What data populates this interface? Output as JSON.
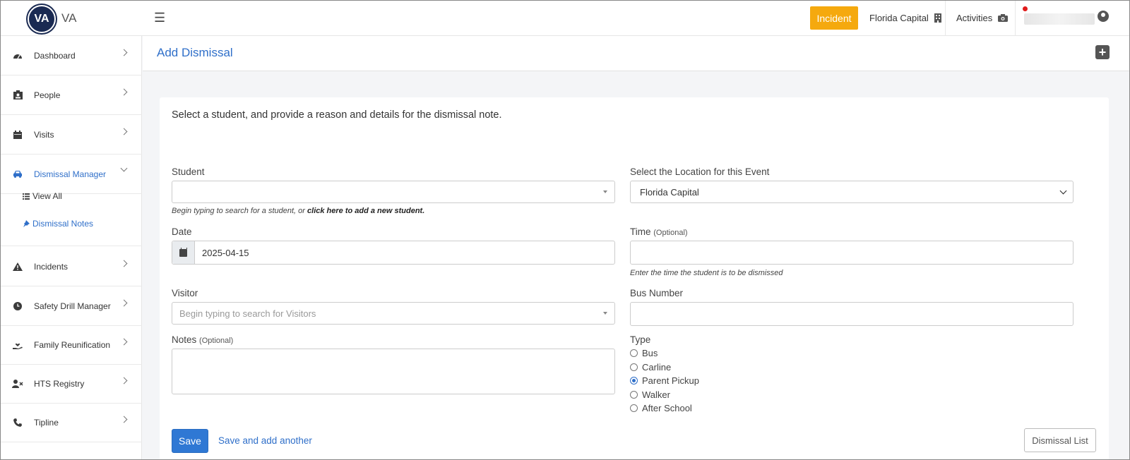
{
  "header": {
    "logo_text": "VA",
    "brand": "VA",
    "incident_label": "Incident",
    "location_label": "Florida Capital",
    "activities_label": "Activities"
  },
  "sidebar": {
    "items": [
      {
        "label": "Dashboard"
      },
      {
        "label": "People"
      },
      {
        "label": "Visits"
      },
      {
        "label": "Dismissal Manager"
      },
      {
        "label": "Incidents"
      },
      {
        "label": "Safety Drill Manager"
      },
      {
        "label": "Family Reunification"
      },
      {
        "label": "HTS Registry"
      },
      {
        "label": "Tipline"
      }
    ],
    "sub_items": [
      {
        "label": "View All"
      },
      {
        "label": "Dismissal Notes"
      }
    ]
  },
  "page": {
    "title": "Add Dismissal"
  },
  "form": {
    "intro": "Select a student, and provide a reason and details for the dismissal note.",
    "student_label": "Student",
    "student_help_prefix": "Begin typing to search for a student, or ",
    "student_help_link": "click here to add a new student.",
    "location_label": "Select the Location for this Event",
    "location_value": "Florida Capital",
    "date_label": "Date",
    "date_value": "2025-04-15",
    "time_label": "Time",
    "optional": "(Optional)",
    "time_help": "Enter the time the student is to be dismissed",
    "visitor_label": "Visitor",
    "visitor_placeholder": "Begin typing to search for Visitors",
    "bus_label": "Bus Number",
    "notes_label": "Notes",
    "type_label": "Type",
    "type_options": [
      {
        "label": "Bus",
        "checked": false
      },
      {
        "label": "Carline",
        "checked": false
      },
      {
        "label": "Parent Pickup",
        "checked": true
      },
      {
        "label": "Walker",
        "checked": false
      },
      {
        "label": "After School",
        "checked": false
      }
    ],
    "save_label": "Save",
    "save_another_label": "Save and add another",
    "dismissal_list_label": "Dismissal List"
  },
  "colors": {
    "accent": "#2f6fc9",
    "incident": "#f5a90e",
    "brand_navy": "#1a2a52"
  }
}
